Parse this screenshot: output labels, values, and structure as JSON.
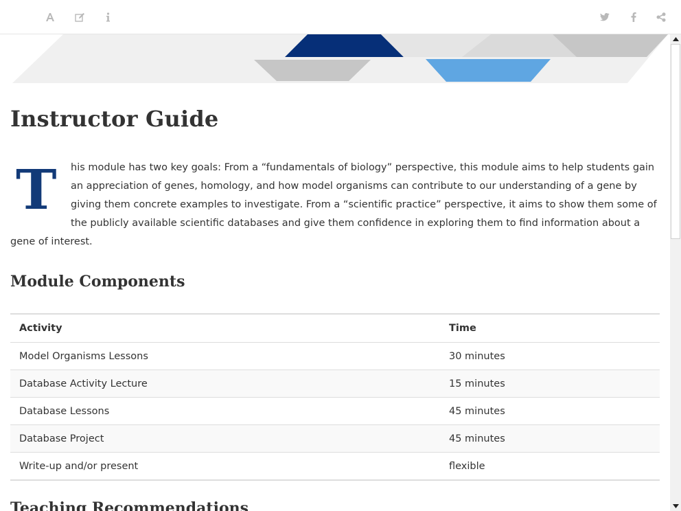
{
  "toolbar": {
    "left_icons": [
      "font-settings-icon",
      "edit-icon",
      "info-icon"
    ],
    "right_icons": [
      "twitter-icon",
      "facebook-icon",
      "share-icon"
    ]
  },
  "colors": {
    "dropcap": "#123a78",
    "banner_navy": "#062f78",
    "banner_blue": "#5fa6e2",
    "banner_gray": "#c6c6c6",
    "banner_light": "#ececec"
  },
  "page": {
    "title": "Instructor Guide",
    "intro_dropcap": "T",
    "intro_text": "his module has two key goals: From a “fundamentals of biology” perspective, this module aims to help students gain an appreciation of genes, homology, and how model organisms can contribute to our understanding of a gene by giving them concrete examples to investigate. From a “scientific practice” perspective, it aims to show them some of the publicly available scientific databases and give them confidence in exploring them to find information about a gene of interest.",
    "components_heading": "Module Components",
    "next_heading": "Teaching Recommendations"
  },
  "table": {
    "headers": [
      "Activity",
      "Time"
    ],
    "rows": [
      [
        "Model Organisms Lessons",
        "30 minutes"
      ],
      [
        "Database Activity Lecture",
        "15 minutes"
      ],
      [
        "Database Lessons",
        "45 minutes"
      ],
      [
        "Database Project",
        "45 minutes"
      ],
      [
        "Write-up and/or present",
        "flexible"
      ]
    ]
  }
}
